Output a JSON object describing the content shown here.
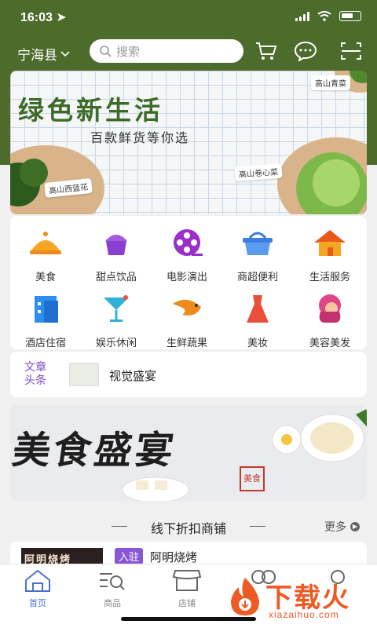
{
  "status_bar": {
    "time": "16:03"
  },
  "header": {
    "city": "宁海县",
    "search_placeholder": "搜索"
  },
  "banner": {
    "title": "绿色新生活",
    "subtitle": "百款鲜货等你选",
    "tags": [
      "高山西蓝花",
      "高山卷心菜",
      "高山青菜"
    ]
  },
  "categories": [
    {
      "label": "美食",
      "icon": "food-icon",
      "color": "#f5a623"
    },
    {
      "label": "甜点饮品",
      "icon": "cake-icon",
      "color": "#8b3fd1"
    },
    {
      "label": "电影演出",
      "icon": "film-reel-icon",
      "color": "#9b2fc8"
    },
    {
      "label": "商超便利",
      "icon": "basket-icon",
      "color": "#3b7de0"
    },
    {
      "label": "生活服务",
      "icon": "house-icon",
      "color": "#f08a1c"
    },
    {
      "label": "酒店住宿",
      "icon": "hotel-icon",
      "color": "#2b8ef0"
    },
    {
      "label": "娱乐休闲",
      "icon": "cocktail-icon",
      "color": "#2fb0d8"
    },
    {
      "label": "生鲜蔬果",
      "icon": "shrimp-icon",
      "color": "#f08a1c"
    },
    {
      "label": "美妆",
      "icon": "dress-icon",
      "color": "#e8503a"
    },
    {
      "label": "美容美发",
      "icon": "hair-icon",
      "color": "#e0458a"
    }
  ],
  "news": {
    "tag_line1": "文章",
    "tag_line2": "头条",
    "headline": "视觉盛宴"
  },
  "promo": {
    "title": "美食盛宴",
    "stamp": "美食"
  },
  "section": {
    "title": "线下折扣商铺",
    "more": "更多"
  },
  "shop": {
    "thumb_text": "阿明烧烤",
    "badge": "入驻",
    "name": "阿明烧烤"
  },
  "tabs": [
    {
      "label": "首页",
      "icon": "home-icon",
      "active": true
    },
    {
      "label": "商品",
      "icon": "goods-search-icon",
      "active": false
    },
    {
      "label": "店铺",
      "icon": "store-icon",
      "active": false
    },
    {
      "label": "",
      "icon": "chat-icon",
      "active": false
    },
    {
      "label": "",
      "icon": "profile-icon",
      "active": false
    }
  ],
  "watermark": {
    "text": "下载火",
    "url": "xiazaihuo.com"
  },
  "colors": {
    "header_green": "#4d6b2a",
    "accent_purple": "#8a55d6",
    "tab_active": "#4a6fd0"
  }
}
